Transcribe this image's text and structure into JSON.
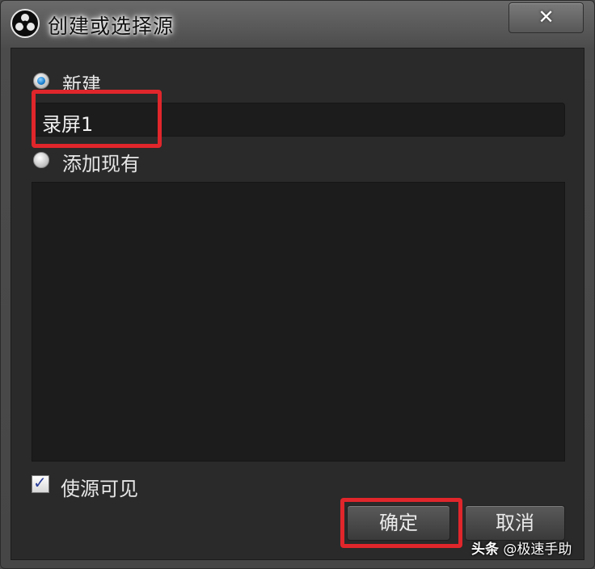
{
  "window": {
    "title": "创建或选择源",
    "close_glyph": "✕",
    "logo_icon": "obs-logo-icon"
  },
  "options": {
    "create_new_label": "新建",
    "create_new_checked": true,
    "add_existing_label": "添加现有",
    "add_existing_checked": false
  },
  "name_field": {
    "value": "录屏1"
  },
  "source_list": {
    "items": []
  },
  "visibility": {
    "label": "使源可见",
    "checked": true
  },
  "buttons": {
    "ok_label": "确定",
    "cancel_label": "取消"
  },
  "watermark": {
    "platform": "头条",
    "handle": "@极速手助"
  },
  "colors": {
    "highlight": "#e0262b",
    "radio_accent": "#1a7fd0"
  }
}
